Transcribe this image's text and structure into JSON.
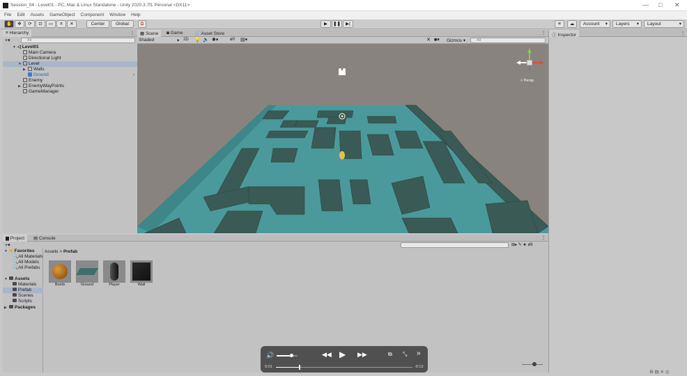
{
  "window": {
    "title": "Session_04 - Level01 - PC, Mac & Linux Standalone - Unity 2020.3.7f1 Personal <DX11>",
    "controls": [
      "—",
      "□",
      "✕"
    ]
  },
  "menu": [
    "File",
    "Edit",
    "Assets",
    "GameObject",
    "Component",
    "Window",
    "Help"
  ],
  "toolbar": {
    "pivot_label": "Center",
    "space_label": "Global",
    "account_label": "Account",
    "layers_label": "Layers",
    "layout_label": "Layout"
  },
  "hierarchy": {
    "tab_label": "Hierarchy",
    "search_placeholder": "All",
    "scene_name": "Level01",
    "items": [
      {
        "label": "Main Camera",
        "indent": 1
      },
      {
        "label": "Directional Light",
        "indent": 1
      },
      {
        "label": "Level",
        "indent": 1,
        "expanded": true,
        "selected": true
      },
      {
        "label": "Walls",
        "indent": 2,
        "collapsed": true
      },
      {
        "label": "Ground",
        "indent": 2,
        "highlight": true
      },
      {
        "label": "Enemy",
        "indent": 1
      },
      {
        "label": "EnemyWayPoints",
        "indent": 1,
        "collapsed": true
      },
      {
        "label": "GameManager",
        "indent": 1
      }
    ]
  },
  "scene_view": {
    "tabs": [
      "Scene",
      "Game",
      "Asset Store"
    ],
    "shading_mode": "Shaded",
    "mode_2d": "2D",
    "gizmos_label": "Gizmos",
    "search_placeholder": "All",
    "persp_label": "< Persp",
    "visibility_count": "0"
  },
  "inspector": {
    "tab_label": "Inspector"
  },
  "project": {
    "tabs": [
      "Project",
      "Console"
    ],
    "favorites_label": "Favorites",
    "favorites": [
      "All Materials",
      "All Models",
      "All Prefabs"
    ],
    "assets_label": "Assets",
    "asset_folders": [
      "Materials",
      "Prefab",
      "Scenes",
      "Scripts"
    ],
    "packages_label": "Packages",
    "breadcrumb": [
      "Assets",
      "Prefab"
    ],
    "breadcrumb_sep": ">",
    "prefabs": [
      {
        "name": "Bomb",
        "color": "#b06a14"
      },
      {
        "name": "Ground",
        "color": "#3f7b7c"
      },
      {
        "name": "Player",
        "color": "#222222"
      },
      {
        "name": "Wall",
        "color": "#1c1c1c"
      }
    ],
    "hidden_count": "9"
  },
  "video_player": {
    "current_time": "0:01",
    "remaining_time": "-0:13",
    "progress": 0.17,
    "volume": 0.7
  },
  "colors": {
    "ground": "#4a9a9b",
    "wall": "#3a5a55",
    "sky": "#8a8580",
    "selection": "#a9b6c7"
  }
}
